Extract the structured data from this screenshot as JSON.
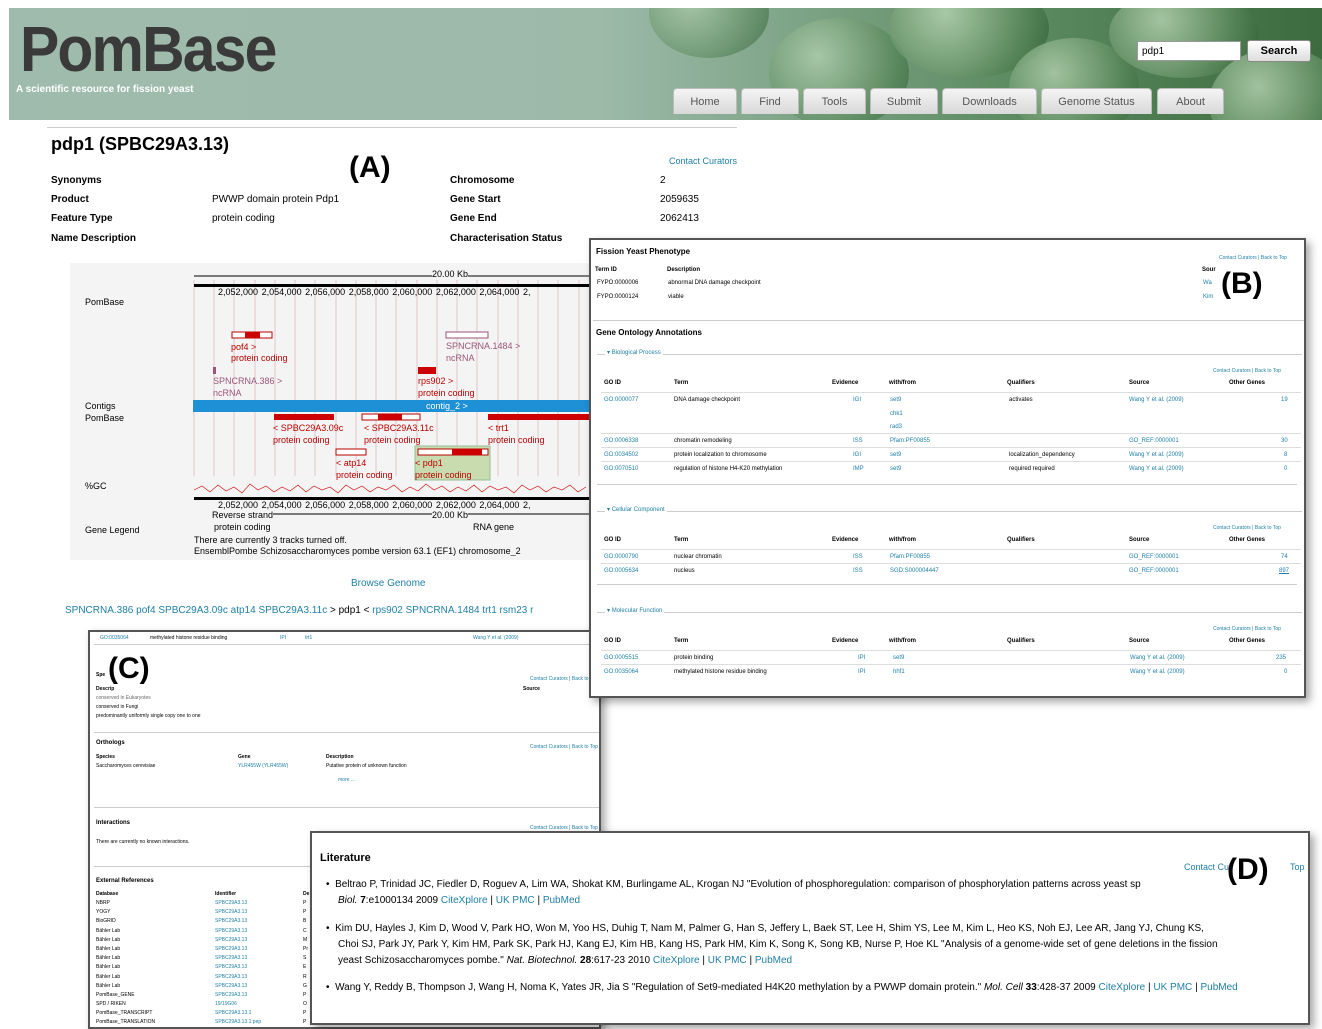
{
  "header": {
    "logo": "PomBase",
    "tagline": "A scientific resource for fission yeast",
    "search_value": "pdp1",
    "search_button": "Search",
    "tabs": [
      "Home",
      "Find",
      "Tools",
      "Submit",
      "Downloads",
      "Genome Status",
      "About"
    ]
  },
  "gene": {
    "title": "pdp1 (SPBC29A3.13)",
    "contact": "Contact Curators",
    "left": [
      [
        "Synonyms",
        ""
      ],
      [
        "Product",
        "PWWP domain protein Pdp1"
      ],
      [
        "Feature Type",
        "protein coding"
      ],
      [
        "Name Description",
        ""
      ]
    ],
    "right": [
      [
        "Chromosome",
        "2"
      ],
      [
        "Gene Start",
        "2059635"
      ],
      [
        "Gene End",
        "2062413"
      ],
      [
        "Characterisation Status",
        ""
      ]
    ]
  },
  "labels": {
    "a": "(A)",
    "b": "(B)",
    "c": "(C)",
    "d": "(D)"
  },
  "browser": {
    "row_pombase": "PomBase",
    "row_contigs": "Contigs",
    "row_contigs2": "PomBase",
    "row_gc": "%GC",
    "row_legend": "Gene Legend",
    "scale": "20.00 Kb",
    "ticks": [
      "2,052,000",
      "2,054,000",
      "2,056,000",
      "2,058,000",
      "2,060,000",
      "2,062,000",
      "2,064,000",
      "2,"
    ],
    "ticks2": [
      "2,052,000",
      "2,054,000",
      "2,056,000",
      "2,058,000",
      "2,060,000",
      "2,062,000",
      "2,064,000",
      "2,"
    ],
    "pof4": "pof4 >",
    "pof4_t": "protein coding",
    "ncrna1": "SPNCRNA.1484 >",
    "ncrna1_t": "ncRNA",
    "ncrna2": "SPNCRNA.386 >",
    "ncrna2_t": "ncRNA",
    "rps902": "rps902 >",
    "rps902_t": "protein coding",
    "contig": "contig_2 >",
    "g1": "< SPBC29A3.09c",
    "g1t": "protein coding",
    "g2": "< SPBC29A3.11c",
    "g2t": "protein coding",
    "g3": "< trt1",
    "g3t": "protein coding",
    "g4": "< atp14",
    "g4t": "protein coding",
    "g5": "< pdp1",
    "g5t": "protein coding",
    "reverse": "Reverse strand",
    "legend_pc": "protein coding",
    "legend_rna": "RNA gene",
    "note1": "There are currently 3 tracks turned off.",
    "note2": "EnsemblPombe Schizosaccharomyces pombe version 63.1 (EF1) chromosome_2"
  },
  "browse_genome": "Browse Genome",
  "neighbours": {
    "before": "SPNCRNA.386 pof4 SPBC29A3.09c atp14 SPBC29A3.11c",
    "mid": "> pdp1 <",
    "after": "rps902 SPNCRNA.1484 trt1 rsm23 r"
  },
  "panelB": {
    "title": "Fission Yeast Phenotype",
    "contact": "Contact Curators | Back to Top",
    "cols": [
      "Term ID",
      "Description",
      "Sour"
    ],
    "rows": [
      [
        "FYPO:0000006",
        "abnormal DNA damage checkpoint",
        "Wa"
      ],
      [
        "FYPO:0000124",
        "viable",
        "Kim"
      ]
    ],
    "go_title": "Gene Ontology Annotations",
    "bp": "Biological Process",
    "cc": "Cellular Component",
    "mf": "Molecular Function",
    "gocols": [
      "GO ID",
      "Term",
      "Evidence",
      "with/from",
      "Qualifiers",
      "Source",
      "Other Genes"
    ],
    "bp_rows": [
      [
        "GO:0000077",
        "DNA damage checkpoint",
        "IGI",
        "set9",
        "activates",
        "Wang Y et al. (2009)",
        "19"
      ],
      [
        "",
        "",
        "",
        "chk1",
        "",
        "",
        ""
      ],
      [
        "",
        "",
        "",
        "rad3",
        "",
        "",
        ""
      ],
      [
        "GO:0006338",
        "chromatin remodeling",
        "ISS",
        "Pfam:PF00855",
        "",
        "GO_REF:0000001",
        "30"
      ],
      [
        "GO:0034502",
        "protein localization to chromosome",
        "IGI",
        "set9",
        "localization_dependency",
        "Wang Y et al. (2009)",
        "8"
      ],
      [
        "GO:0070510",
        "regulation of histone H4-K20 methylation",
        "IMP",
        "set9",
        "required required",
        "Wang Y et al. (2009)",
        "0"
      ]
    ],
    "cc_rows": [
      [
        "GO:0000790",
        "nuclear chromatin",
        "ISS",
        "Pfam:PF00855",
        "",
        "GO_REF:0000001",
        "74"
      ],
      [
        "GO:0005634",
        "nucleus",
        "ISS",
        "SGD:S000004447",
        "",
        "GO_REF:0000001",
        "897"
      ]
    ],
    "mf_rows": [
      [
        "GO:0005515",
        "protein binding",
        "IPI",
        "set9",
        "",
        "Wang Y et al. (2009)",
        "235"
      ],
      [
        "GO:0035064",
        "methylated histone residue binding",
        "IPI",
        "hhf1",
        "",
        "Wang Y et al. (2009)",
        "0"
      ]
    ]
  },
  "panelC": {
    "top_row": [
      "GO:0035064",
      "methylated histone residue binding",
      "IPI",
      "trt1",
      "Wang Y et al. (2009)"
    ],
    "spec": "Spe",
    "desc": "Descrip",
    "source": "Source",
    "contact": "Contact Curators | Back to Top",
    "conservation": [
      "conserved in Eukaryotes",
      "conserved in Fungi",
      "predominantly uniformly single copy one to one"
    ],
    "orthologs": "Orthologs",
    "orth_cols": [
      "Species",
      "Gene",
      "Description"
    ],
    "orth_row": [
      "Saccharomyces cerevisiae",
      "YLR455W (YLR455W)",
      "Putative protein of unknown function"
    ],
    "more": "more ...",
    "interactions": "Interactions",
    "no_int": "There are currently no known interactions.",
    "ext": "External References",
    "ext_cols": [
      "Database",
      "Identifier",
      "De"
    ],
    "ext_rows": [
      [
        "NBRP",
        "SPBC29A3.13",
        "P"
      ],
      [
        "YOGY",
        "SPBC29A3.13",
        "P"
      ],
      [
        "BioGRID",
        "SPBC29A3.13",
        "B"
      ],
      [
        "Bähler Lab",
        "SPBC29A3.13",
        "C"
      ],
      [
        "Bähler Lab",
        "SPBC29A3.13",
        "M"
      ],
      [
        "Bähler Lab",
        "SPBC29A3.13",
        "Pr"
      ],
      [
        "Bähler Lab",
        "SPBC29A3.13",
        "S"
      ],
      [
        "Bähler Lab",
        "SPBC29A3.13",
        "E"
      ],
      [
        "Bähler Lab",
        "SPBC29A3.13",
        "R"
      ],
      [
        "Bähler Lab",
        "SPBC29A3.13",
        "G"
      ],
      [
        "PomBase_GENE",
        "SPBC29A3.13",
        "P"
      ],
      [
        "SPD / RIKEN",
        "19/19G06",
        "O"
      ],
      [
        "PomBase_TRANSCRIPT",
        "SPBC29A3.13.1",
        "P"
      ],
      [
        "PomBase_TRANSLATION",
        "SPBC29A3.13.1:pep",
        "P"
      ]
    ]
  },
  "panelD": {
    "title": "Literature",
    "contact": "Contact Cu",
    "contact2": "Top",
    "ref1a": "Beltrao P, Trinidad JC, Fiedler D, Roguev A, Lim WA, Shokat KM, Burlingame AL, Krogan NJ \"Evolution of phosphoregulation: comparison of phosphorylation patterns across yeast sp",
    "ref1b_journal": "Biol.",
    "ref1b_vol": "7",
    "ref1b_rest": ":e1000134 2009",
    "ref2a": "Kim DU, Hayles J, Kim D, Wood V, Park HO, Won M, Yoo HS, Duhig T, Nam M, Palmer G, Han S, Jeffery L, Baek ST, Lee H, Shim YS, Lee M, Kim L, Heo KS, Noh EJ, Lee AR, Jang YJ, Chung KS,",
    "ref2b": "Choi SJ, Park JY, Park Y, Kim HM, Park SK, Park HJ, Kang EJ, Kim HB, Kang HS, Park HM, Kim K, Song K, Song KB, Nurse P, Hoe KL \"Analysis of a genome-wide set of gene deletions in the fission",
    "ref2c": "yeast Schizosaccharomyces pombe.\"",
    "ref2_journal": "Nat. Biotechnol.",
    "ref2_vol": "28",
    "ref2_rest": ":617-23 2010",
    "ref3a": "Wang Y, Reddy B, Thompson J, Wang H, Noma K, Yates JR, Jia S \"Regulation of Set9-mediated H4K20 methylation by a PWWP domain protein.\"",
    "ref3_journal": "Mol. Cell",
    "ref3_vol": "33",
    "ref3_rest": ":428-37 2009",
    "citexplore": "CiteXplore",
    "ukpmc": "UK PMC",
    "pubmed": "PubMed",
    "sep": "|"
  }
}
